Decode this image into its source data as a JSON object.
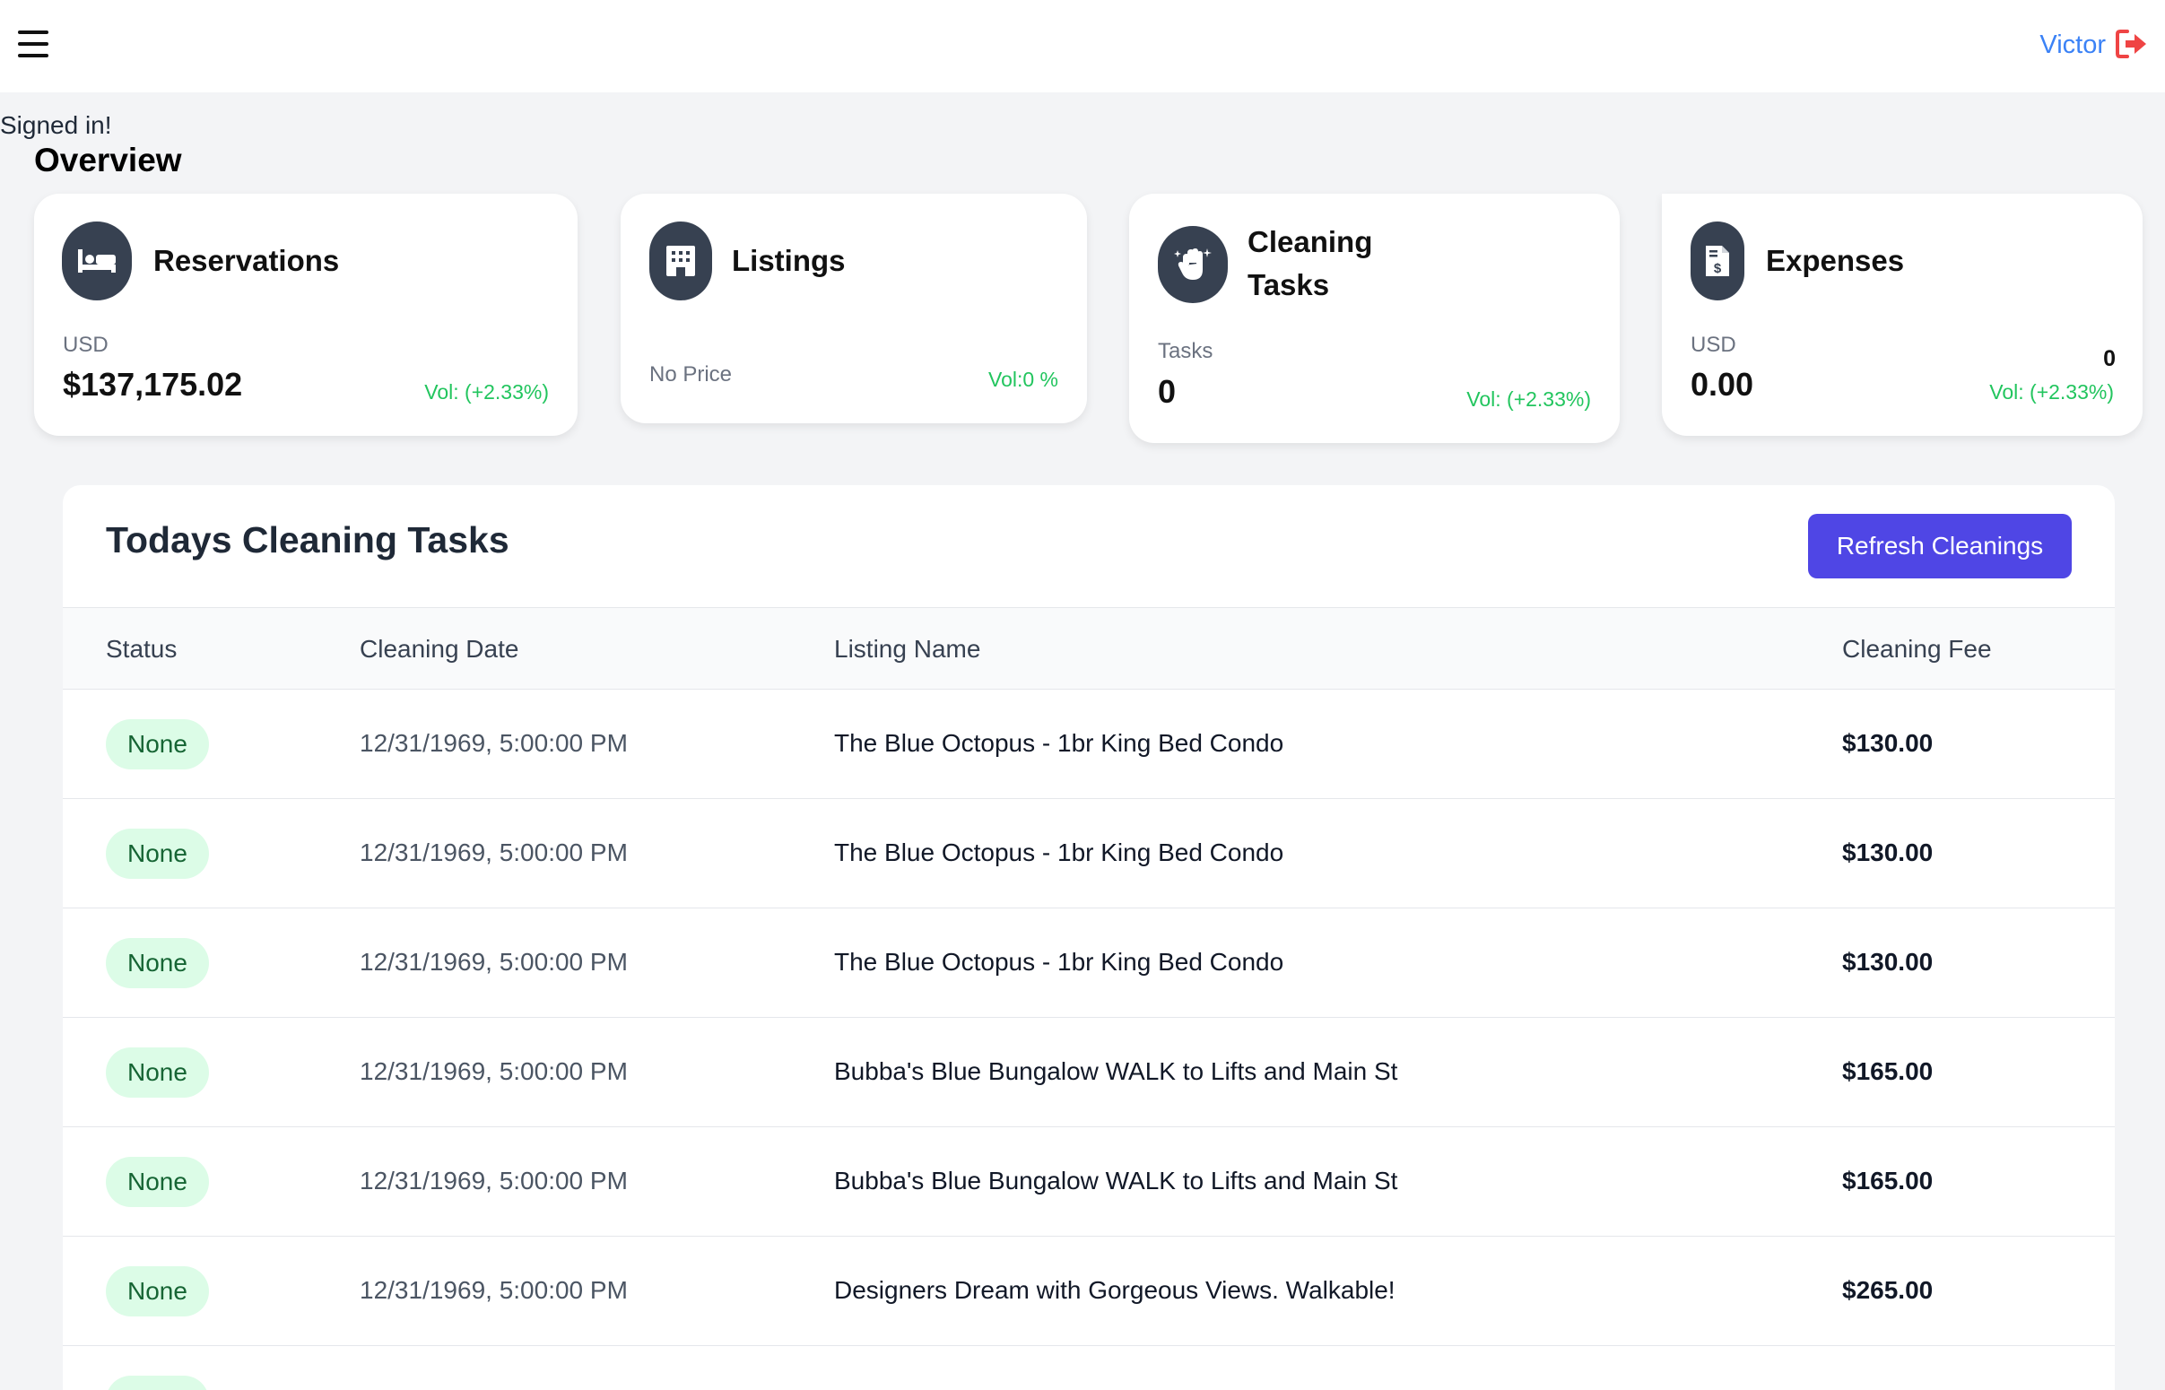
{
  "header": {
    "user_name": "Victor"
  },
  "auth_status": "Signed in!",
  "overview_title": "Overview",
  "cards": {
    "reservations": {
      "title": "Reservations",
      "currency": "USD",
      "value": "$137,175.02",
      "vol": "Vol: (+2.33%)",
      "icon": "bed-icon"
    },
    "listings": {
      "title": "Listings",
      "sub": "No Price",
      "vol": "Vol:0 %",
      "icon": "building-icon"
    },
    "cleaning": {
      "title_line1": "Cleaning",
      "title_line2": "Tasks",
      "sub": "Tasks",
      "value": "0",
      "vol": "Vol: (+2.33%)",
      "icon": "hand-sparkle-icon"
    },
    "expenses": {
      "title": "Expenses",
      "currency": "USD",
      "value": "0.00",
      "count": "0",
      "vol": "Vol: (+2.33%)",
      "icon": "invoice-icon"
    }
  },
  "cleaning_table": {
    "title": "Todays Cleaning Tasks",
    "refresh_label": "Refresh Cleanings",
    "columns": {
      "status": "Status",
      "date": "Cleaning Date",
      "name": "Listing Name",
      "fee": "Cleaning Fee"
    },
    "rows": [
      {
        "status": "None",
        "date": "12/31/1969, 5:00:00 PM",
        "name": "The Blue Octopus - 1br King Bed Condo",
        "fee": "$130.00"
      },
      {
        "status": "None",
        "date": "12/31/1969, 5:00:00 PM",
        "name": "The Blue Octopus - 1br King Bed Condo",
        "fee": "$130.00"
      },
      {
        "status": "None",
        "date": "12/31/1969, 5:00:00 PM",
        "name": "The Blue Octopus - 1br King Bed Condo",
        "fee": "$130.00"
      },
      {
        "status": "None",
        "date": "12/31/1969, 5:00:00 PM",
        "name": "Bubba's Blue Bungalow WALK to Lifts and Main St",
        "fee": "$165.00"
      },
      {
        "status": "None",
        "date": "12/31/1969, 5:00:00 PM",
        "name": "Bubba's Blue Bungalow WALK to Lifts and Main St",
        "fee": "$165.00"
      },
      {
        "status": "None",
        "date": "12/31/1969, 5:00:00 PM",
        "name": "Designers Dream with Gorgeous Views. Walkable!",
        "fee": "$265.00"
      },
      {
        "status": "None",
        "date": "",
        "name": "",
        "fee": ""
      }
    ]
  },
  "colors": {
    "accent": "#4f46e5",
    "user_link": "#3b82f6",
    "logout": "#ef4444",
    "positive": "#22c55e",
    "badge_bg": "#dcfce7",
    "badge_text": "#166534"
  }
}
